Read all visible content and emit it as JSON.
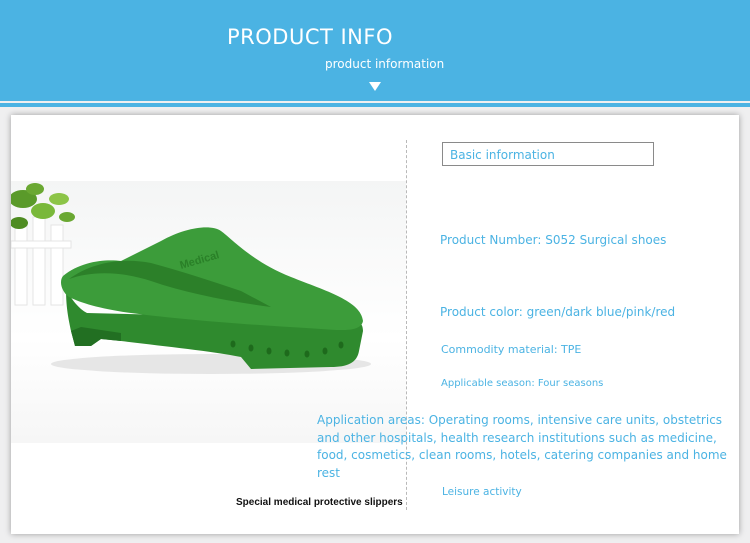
{
  "header": {
    "title": "PRODUCT INFO",
    "subtitle": "product information",
    "background_color": "#4bb3e3",
    "arrow_icon": "triangle-down-icon"
  },
  "product": {
    "image_brand_text": "Medical",
    "caption": "Special medical protective slippers",
    "shoe_color": "#3c9c3a"
  },
  "info": {
    "box_label": "Basic information",
    "product_number": "Product Number: S052 Surgical shoes",
    "product_color": "Product color: green/dark blue/pink/red",
    "material": "Commodity material: TPE",
    "season": "Applicable season: Four seasons",
    "application_areas": "Application areas: Operating rooms, intensive care units, obstetrics and other hospitals, health research institutions such as medicine, food, cosmetics, clean rooms, hotels, catering companies and home rest",
    "leisure": "Leisure activity",
    "text_color": "#4bb3e3"
  }
}
